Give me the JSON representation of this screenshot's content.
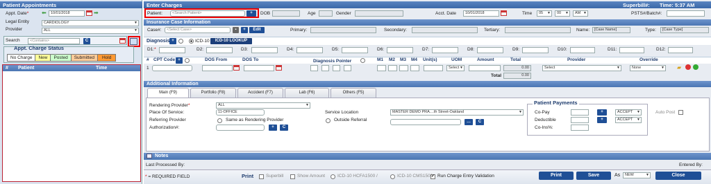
{
  "left": {
    "title": "Patient Appointments",
    "appt_date_label": "Appt. Date",
    "appt_date": "10/01/2018",
    "legal_entity_label": "Legal Entity",
    "legal_entity": "CARDIOLOGY",
    "provider_label": "Provider",
    "provider": "ALL",
    "search_label": "Search",
    "search_placeholder": "<Contains>",
    "c_btn": "C",
    "status_title": "Appt. Charge Status",
    "legend": [
      "No Charge",
      "New",
      "Posted",
      "Submitted",
      "Hold"
    ],
    "legend_colors": [
      "#ffffff",
      "#ffff99",
      "#ccffcc",
      "#ffcc99",
      "#ff9933"
    ],
    "col_num": "#",
    "col_patient": "Patient",
    "col_time": "Time"
  },
  "enter": {
    "title": "Enter Charges",
    "superbill_label": "Superbill#:",
    "time_display": "Time: 5:37 AM",
    "patient_label": "Patient:",
    "patient_placeholder": "<Search Patient>",
    "plus": "+",
    "dob_label": "DOB",
    "age_label": "Age",
    "gender_label": "Gender",
    "acct_date_label": "Acct. Date",
    "acct_date": "10/01/2018",
    "time_label": "Time",
    "hour": "05",
    "minute": "00",
    "ampm": "AM",
    "psts_label": "PSTS#/Batch#:"
  },
  "ins": {
    "title": "Insurance Case Information",
    "case_label": "Case#:",
    "case_placeholder": "<Select Case>",
    "edit": "Edit",
    "primary": "Primary:",
    "secondary": "Secondary:",
    "tertiary": "Tertiary:",
    "name_label": "Name:",
    "name_value": "[Case Name]",
    "type_label": "Type:",
    "type_value": "[Case Type]"
  },
  "diag": {
    "title": "Diagnosis",
    "icd_label": "ICD-10",
    "lookup": "ICD-10 LOOKUP",
    "codes": [
      "D1:",
      "D2:",
      "D3:",
      "D4:",
      "D5:",
      "D6:",
      "D7:",
      "D8:",
      "D9:",
      "D10:",
      "D11:",
      "D12:"
    ]
  },
  "cpt": {
    "hash": "#",
    "cpt_code": "CPT Code",
    "dos_from": "DOS From",
    "dos_to": "DOS To",
    "diag_pointer": "Diagnosis Pointer",
    "m1": "M1",
    "m2": "M2",
    "m3": "M3",
    "m4": "M4",
    "units": "Unit(s)",
    "uom": "UOM",
    "amount": "Amount",
    "total": "Total",
    "provider": "Provider",
    "override": "Override",
    "row_num": "1",
    "uom_sel": "Select",
    "row_total": "0.00",
    "provider_sel": "Select",
    "override_sel": "None",
    "total_label": "Total",
    "grand_total": "0.00"
  },
  "addl": {
    "title": "Additional Information",
    "tabs": [
      "Main (F9)",
      "Portfolio (F8)",
      "Accident (F7)",
      "Lab (F6)",
      "Others (F5)"
    ],
    "rendering_label": "Rendering Provider",
    "rendering_value": "ALL",
    "pos_label": "Place Of Service:",
    "pos_value": "11-OFFICE",
    "referring_label": "Referring Provider",
    "same_as": "Same as Rendering Provider",
    "auth_label": "Authorization#:",
    "service_loc_label": "Service Location",
    "service_loc_value": "MASTER DEMO PRA....th Street-Oakland",
    "outside_ref": "Outside Referral",
    "c_btn": "C",
    "payments_title": "Patient Payments",
    "copay": "Co-Pay",
    "deductible": "Deductible",
    "coins": "Co-Ins%:",
    "accept1": "ACCEPT",
    "accept2": "ACCEPT",
    "auto_post": "Auto Post"
  },
  "notes": {
    "title": "Notes"
  },
  "footer": {
    "last_processed": "Last Processed By:",
    "entered_by": "Entered By:",
    "required": "= REQUIRED FIELD",
    "print_label": "Print",
    "superbill": "Superbill",
    "show_amount": "Show Amount",
    "icd_hcfa": "ICD-10 HCFA1500 /",
    "icd_cms": "ICD-10 CMS1500",
    "run_validation": "Run Charge Entry Validation",
    "print_btn": "Print",
    "save_btn": "Save",
    "as_label": "As",
    "as_value": "NEW",
    "close_btn": "Close"
  }
}
